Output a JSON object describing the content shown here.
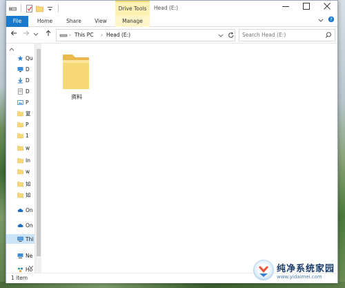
{
  "window": {
    "context_tab": "Drive Tools",
    "title": "Head (E:)"
  },
  "ribbon": {
    "tabs": [
      "File",
      "Home",
      "Share",
      "View",
      "Manage"
    ]
  },
  "address": {
    "crumbs": [
      "This PC",
      "Head (E:)"
    ],
    "search_placeholder": "Search Head (E:)"
  },
  "nav_pane": {
    "items": [
      {
        "label": "Qu",
        "icon": "star-icon"
      },
      {
        "label": "D",
        "icon": "desktop-icon"
      },
      {
        "label": "D",
        "icon": "download-icon"
      },
      {
        "label": "D",
        "icon": "document-icon"
      },
      {
        "label": "P",
        "icon": "picture-icon"
      },
      {
        "label": "复",
        "icon": "folder-icon"
      },
      {
        "label": "P",
        "icon": "folder-icon"
      },
      {
        "label": "1",
        "icon": "folder-icon"
      },
      {
        "label": "w",
        "icon": "folder-icon"
      },
      {
        "label": "In",
        "icon": "folder-icon"
      },
      {
        "label": "w",
        "icon": "folder-icon"
      },
      {
        "label": "如",
        "icon": "folder-icon"
      },
      {
        "label": "如",
        "icon": "folder-icon"
      },
      {
        "label": "On",
        "icon": "cloud-icon"
      },
      {
        "label": "On",
        "icon": "cloud-icon"
      },
      {
        "label": "Thi",
        "icon": "computer-icon"
      },
      {
        "label": "Ne",
        "icon": "network-icon"
      },
      {
        "label": "Ho",
        "icon": "homegroup-icon"
      }
    ]
  },
  "content": {
    "folders": [
      {
        "name": "资料"
      }
    ]
  },
  "status": {
    "item_count": "1 item"
  },
  "watermark": {
    "title": "纯净系统家园",
    "url": "www.yidaimei.com"
  },
  "colors": {
    "file_tab": "#1979ca",
    "selection": "#cce4f7",
    "folder": "#f8d775"
  }
}
